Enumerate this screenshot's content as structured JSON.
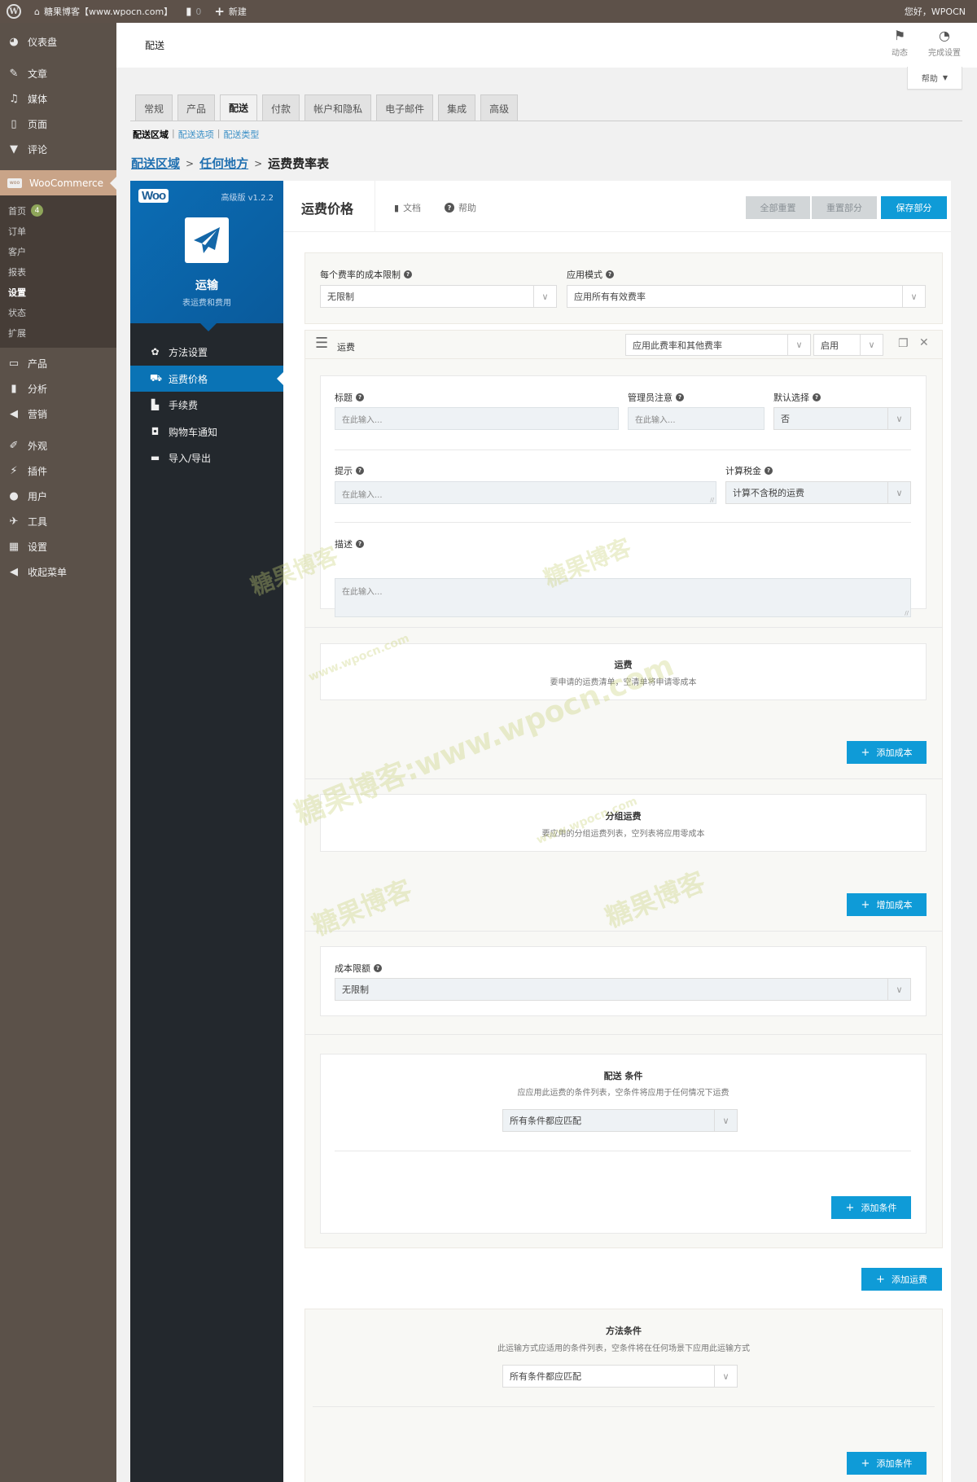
{
  "admin_bar": {
    "site_name": "糖果博客【www.wpocn.com】",
    "comments_count": "0",
    "new_label": "新建",
    "greeting": "您好，WPOCN"
  },
  "sidebar": {
    "items_top": [
      {
        "label": "仪表盘",
        "icon": "dashboard-icon"
      },
      {
        "label": "文章",
        "icon": "pin-icon"
      },
      {
        "label": "媒体",
        "icon": "media-icon"
      },
      {
        "label": "页面",
        "icon": "page-icon"
      },
      {
        "label": "评论",
        "icon": "comment-icon"
      }
    ],
    "woocommerce": {
      "label": "WooCommerce",
      "icon_text": "woo"
    },
    "woo_sub": [
      {
        "label": "首页",
        "badge": "4"
      },
      {
        "label": "订单"
      },
      {
        "label": "客户"
      },
      {
        "label": "报表"
      },
      {
        "label": "设置",
        "current": true
      },
      {
        "label": "状态"
      },
      {
        "label": "扩展"
      }
    ],
    "items_bottom": [
      {
        "label": "产品",
        "icon": "archive-icon"
      },
      {
        "label": "分析",
        "icon": "chart-icon"
      },
      {
        "label": "营销",
        "icon": "megaphone-icon"
      },
      {
        "label": "外观",
        "icon": "brush-icon"
      },
      {
        "label": "插件",
        "icon": "plugin-icon"
      },
      {
        "label": "用户",
        "icon": "user-icon"
      },
      {
        "label": "工具",
        "icon": "wrench-icon"
      },
      {
        "label": "设置",
        "icon": "settings-icon"
      },
      {
        "label": "收起菜单",
        "icon": "collapse-icon"
      }
    ]
  },
  "header": {
    "title": "配送",
    "activity_label": "动态",
    "finish_setup_label": "完成设置",
    "help_label": "帮助"
  },
  "tabs": [
    {
      "label": "常规"
    },
    {
      "label": "产品"
    },
    {
      "label": "配送",
      "active": true
    },
    {
      "label": "付款"
    },
    {
      "label": "帐户和隐私"
    },
    {
      "label": "电子邮件"
    },
    {
      "label": "集成"
    },
    {
      "label": "高级"
    }
  ],
  "sublinks": {
    "current": "配送区域",
    "links": [
      "配送选项",
      "配送类型"
    ]
  },
  "breadcrumb": {
    "link1": "配送区域",
    "link2": "任何地方",
    "current": "运费费率表",
    "separator": ">"
  },
  "plugin": {
    "logo": "Woo",
    "version": "高级版 v1.2.2",
    "title": "运输",
    "subtitle": "表运费和费用",
    "nav": [
      {
        "label": "方法设置",
        "icon": "gear-icon"
      },
      {
        "label": "运费价格",
        "icon": "truck-icon",
        "active": true
      },
      {
        "label": "手续费",
        "icon": "hand-cart-icon"
      },
      {
        "label": "购物车通知",
        "icon": "cart-notice-icon"
      },
      {
        "label": "导入/导出",
        "icon": "import-export-icon"
      }
    ]
  },
  "content": {
    "title": "运费价格",
    "docs_label": "文档",
    "help_label": "帮助",
    "reset_all_label": "全部重置",
    "reset_section_label": "重置部分",
    "save_section_label": "保存部分",
    "cost_limit_label": "每个费率的成本限制",
    "cost_limit_value": "无限制",
    "apply_mode_label": "应用模式",
    "apply_mode_value": "应用所有有效费率",
    "rate": {
      "name": "运费",
      "combine_value": "应用此费率和其他费率",
      "status_value": "启用",
      "title_label": "标题",
      "title_placeholder": "在此输入...",
      "admin_note_label": "管理员注意",
      "admin_note_placeholder": "在此输入...",
      "default_label": "默认选择",
      "default_value": "否",
      "tip_label": "提示",
      "tip_placeholder": "在此输入...",
      "tax_label": "计算税金",
      "tax_value": "计算不含税的运费",
      "desc_label": "描述",
      "desc_placeholder": "在此输入...",
      "costs_title": "运费",
      "costs_sub": "要申请的运费清单，空清单将申请零成本",
      "add_cost_label": "添加成本",
      "group_title": "分组运费",
      "group_sub": "要应用的分组运费列表，空列表将应用零成本",
      "add_group_cost_label": "增加成本",
      "cost_cap_label": "成本限额",
      "cost_cap_value": "无限制",
      "cond_title": "配送 条件",
      "cond_sub": "应应用此运费的条件列表，空条件将应用于任何情况下运费",
      "cond_match_value": "所有条件都应匹配",
      "add_cond_label": "添加条件"
    },
    "add_rate_label": "添加运费",
    "method_cond_title": "方法条件",
    "method_cond_sub": "此运输方式应适用的条件列表，空条件将在任何场景下应用此运输方式",
    "method_cond_value": "所有条件都应匹配",
    "method_add_cond_label": "添加条件"
  },
  "watermarks": [
    "糖果博客",
    "糖果博客",
    "www.wpocn.com",
    "糖果博客:www.wpocn.com",
    "www.wpocn.com",
    "糖果博客",
    "糖果博客"
  ],
  "colors": {
    "accent": "#0f9bd7",
    "nav_active": "#0a73b5",
    "admin_bar": "#5d5149",
    "woo_highlight": "#c9a488"
  }
}
